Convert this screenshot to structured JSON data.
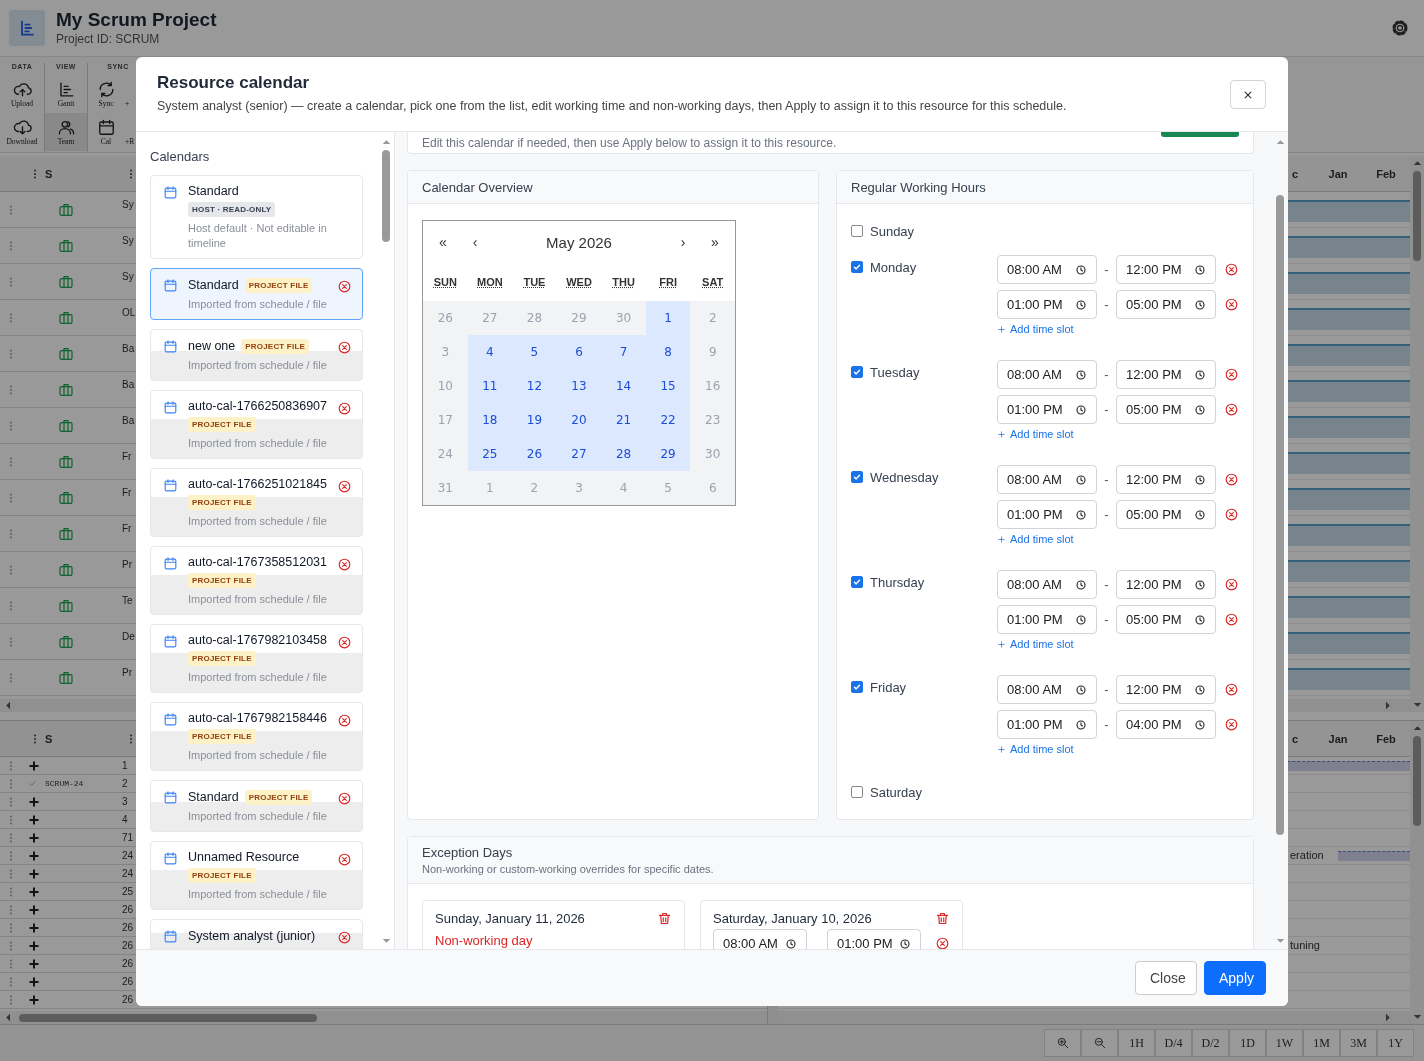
{
  "app": {
    "title": "My Scrum Project",
    "subtitle": "Project ID: SCRUM"
  },
  "toolbar": {
    "groups": [
      {
        "label": "DATA",
        "columns": [
          [
            {
              "label": "Upload",
              "selected": false
            },
            {
              "label": "Download",
              "selected": false
            }
          ]
        ]
      },
      {
        "label": "VIEW",
        "columns": [
          [
            {
              "label": "Gantt",
              "selected": false
            },
            {
              "label": "Team",
              "selected": true
            }
          ]
        ]
      },
      {
        "label": "SYNC",
        "columns": [
          [
            {
              "label": "Sync",
              "selected": false
            },
            {
              "label": "Cal",
              "selected": false
            }
          ],
          [
            {
              "label": "+",
              "selected": false
            },
            {
              "label": "+R",
              "selected": false
            }
          ]
        ]
      }
    ]
  },
  "upper_grid": {
    "column_1": "S",
    "months": [
      "c",
      "Jan",
      "Feb"
    ],
    "rows": [
      {
        "text": "Sy"
      },
      {
        "text": "Sy"
      },
      {
        "text": "Sy"
      },
      {
        "text": "OL"
      },
      {
        "text": "Ba"
      },
      {
        "text": "Ba"
      },
      {
        "text": "Ba"
      },
      {
        "text": "Fr"
      },
      {
        "text": "Fr"
      },
      {
        "text": "Fr"
      },
      {
        "text": "Pr"
      },
      {
        "text": "Te"
      },
      {
        "text": "De"
      },
      {
        "text": "Pr"
      }
    ]
  },
  "lower_grid": {
    "column_1": "S",
    "months": [
      "c",
      "Jan",
      "Feb"
    ],
    "rows": [
      {
        "kind": "new",
        "number": "1",
        "bar": true
      },
      {
        "kind": "done",
        "key": "SCRUM-24",
        "number": "2",
        "bar": false
      },
      {
        "kind": "new",
        "number": "3",
        "bar": false
      },
      {
        "kind": "new",
        "number": "4",
        "bar": false
      },
      {
        "kind": "new",
        "number": "71",
        "bar": false
      },
      {
        "kind": "new",
        "number": "24",
        "bar": true,
        "gantt_label": "eration"
      },
      {
        "kind": "new",
        "number": "24",
        "bar": false
      },
      {
        "kind": "new",
        "number": "25",
        "bar": false
      },
      {
        "kind": "new",
        "number": "26",
        "bar": false
      },
      {
        "kind": "new",
        "number": "26",
        "bar": false
      },
      {
        "kind": "new",
        "number": "26",
        "bar": false,
        "gantt_label": "tuning"
      },
      {
        "kind": "new",
        "number": "26",
        "bar": false
      },
      {
        "kind": "new",
        "number": "26",
        "bar": false
      },
      {
        "kind": "new",
        "number": "26",
        "bar": false
      }
    ]
  },
  "bottom_bar": {
    "scales": [
      "1H",
      "D/4",
      "D/2",
      "1D",
      "1W",
      "1M",
      "3M",
      "1Y"
    ]
  },
  "modal": {
    "title": "Resource calendar",
    "subtitle": "System analyst (senior) — create a calendar, pick one from the list, edit working time and non-working days, then Apply to assign it to this resource for this schedule.",
    "intro": "Edit this calendar if needed, then use Apply below to assign it to this resource.",
    "calendars_heading": "Calendars",
    "calendars": [
      {
        "kind": "host",
        "name": "Standard",
        "badge": "HOST · READ-ONLY",
        "note": "Host default · Not editable in timeline",
        "selected": false
      },
      {
        "kind": "project",
        "name": "Standard",
        "badge": "PROJECT FILE",
        "note": "Imported from schedule / file",
        "selected": true
      },
      {
        "kind": "project",
        "name": "new one",
        "badge": "PROJECT FILE",
        "note": "Imported from schedule / file",
        "selected": false
      },
      {
        "kind": "project",
        "name": "auto-cal-1766250836907",
        "badge": "PROJECT FILE",
        "note": "Imported from schedule / file",
        "selected": false
      },
      {
        "kind": "project",
        "name": "auto-cal-1766251021845",
        "badge": "PROJECT FILE",
        "note": "Imported from schedule / file",
        "selected": false
      },
      {
        "kind": "project",
        "name": "auto-cal-1767358512031",
        "badge": "PROJECT FILE",
        "note": "Imported from schedule / file",
        "selected": false
      },
      {
        "kind": "project",
        "name": "auto-cal-1767982103458",
        "badge": "PROJECT FILE",
        "note": "Imported from schedule / file",
        "selected": false
      },
      {
        "kind": "project",
        "name": "auto-cal-1767982158446",
        "badge": "PROJECT FILE",
        "note": "Imported from schedule / file",
        "selected": false
      },
      {
        "kind": "project",
        "name": "Standard",
        "badge": "PROJECT FILE",
        "note": "Imported from schedule / file",
        "selected": false
      },
      {
        "kind": "project",
        "name": "Unnamed Resource",
        "badge": "PROJECT FILE",
        "note": "Imported from schedule / file",
        "selected": false
      },
      {
        "kind": "project",
        "name": "System analyst (junior)",
        "selected": false
      }
    ],
    "overview": {
      "title": "Calendar Overview",
      "month": "May 2026",
      "nav": [
        "«",
        "‹",
        "›",
        "»"
      ],
      "weekdays": [
        "SUN",
        "MON",
        "TUE",
        "WED",
        "THU",
        "FRI",
        "SAT"
      ],
      "weeks": [
        [
          {
            "day": "26",
            "working": false
          },
          {
            "day": "27",
            "working": false
          },
          {
            "day": "28",
            "working": false
          },
          {
            "day": "29",
            "working": false
          },
          {
            "day": "30",
            "working": false
          },
          {
            "day": "1",
            "working": true
          },
          {
            "day": "2",
            "working": false
          }
        ],
        [
          {
            "day": "3",
            "working": false
          },
          {
            "day": "4",
            "working": true
          },
          {
            "day": "5",
            "working": true
          },
          {
            "day": "6",
            "working": true
          },
          {
            "day": "7",
            "working": true
          },
          {
            "day": "8",
            "working": true
          },
          {
            "day": "9",
            "working": false
          }
        ],
        [
          {
            "day": "10",
            "working": false
          },
          {
            "day": "11",
            "working": true
          },
          {
            "day": "12",
            "working": true
          },
          {
            "day": "13",
            "working": true
          },
          {
            "day": "14",
            "working": true
          },
          {
            "day": "15",
            "working": true
          },
          {
            "day": "16",
            "working": false
          }
        ],
        [
          {
            "day": "17",
            "working": false
          },
          {
            "day": "18",
            "working": true
          },
          {
            "day": "19",
            "working": true
          },
          {
            "day": "20",
            "working": true
          },
          {
            "day": "21",
            "working": true
          },
          {
            "day": "22",
            "working": true
          },
          {
            "day": "23",
            "working": false
          }
        ],
        [
          {
            "day": "24",
            "working": false
          },
          {
            "day": "25",
            "working": true
          },
          {
            "day": "26",
            "working": true
          },
          {
            "day": "27",
            "working": true
          },
          {
            "day": "28",
            "working": true
          },
          {
            "day": "29",
            "working": true
          },
          {
            "day": "30",
            "working": false
          }
        ],
        [
          {
            "day": "31",
            "working": false
          },
          {
            "day": "1",
            "working": false
          },
          {
            "day": "2",
            "working": false
          },
          {
            "day": "3",
            "working": false
          },
          {
            "day": "4",
            "working": false
          },
          {
            "day": "5",
            "working": false
          },
          {
            "day": "6",
            "working": false
          }
        ]
      ]
    },
    "working_hours": {
      "title": "Regular Working Hours",
      "days": [
        {
          "name": "Sunday",
          "checked": false
        },
        {
          "name": "Monday",
          "checked": true,
          "slots": [
            {
              "start": "08:00 AM",
              "separator": "-",
              "end": "12:00 PM"
            },
            {
              "start": "01:00 PM",
              "separator": "-",
              "end": "05:00 PM"
            }
          ],
          "add_slot": "Add time slot"
        },
        {
          "name": "Tuesday",
          "checked": true,
          "slots": [
            {
              "start": "08:00 AM",
              "separator": "-",
              "end": "12:00 PM"
            },
            {
              "start": "01:00 PM",
              "separator": "-",
              "end": "05:00 PM"
            }
          ],
          "add_slot": "Add time slot"
        },
        {
          "name": "Wednesday",
          "checked": true,
          "slots": [
            {
              "start": "08:00 AM",
              "separator": "-",
              "end": "12:00 PM"
            },
            {
              "start": "01:00 PM",
              "separator": "-",
              "end": "05:00 PM"
            }
          ],
          "add_slot": "Add time slot"
        },
        {
          "name": "Thursday",
          "checked": true,
          "slots": [
            {
              "start": "08:00 AM",
              "separator": "-",
              "end": "12:00 PM"
            },
            {
              "start": "01:00 PM",
              "separator": "-",
              "end": "05:00 PM"
            }
          ],
          "add_slot": "Add time slot"
        },
        {
          "name": "Friday",
          "checked": true,
          "slots": [
            {
              "start": "08:00 AM",
              "separator": "-",
              "end": "12:00 PM"
            },
            {
              "start": "01:00 PM",
              "separator": "-",
              "end": "04:00 PM"
            }
          ],
          "add_slot": "Add time slot"
        },
        {
          "name": "Saturday",
          "checked": false
        }
      ]
    },
    "exceptions": {
      "title": "Exception Days",
      "subtitle": "Non-working or custom-working overrides for specific dates.",
      "items": [
        {
          "kind": "off",
          "date": "Sunday, January 11, 2026",
          "note": "Non-working day"
        },
        {
          "kind": "custom",
          "date": "Saturday, January 10, 2026",
          "slots": [
            {
              "start": "08:00 AM",
              "end": "01:00 PM"
            }
          ]
        }
      ]
    },
    "buttons": [
      {
        "label": "Close",
        "kind": "secondary"
      },
      {
        "label": "Apply",
        "kind": "primary"
      }
    ]
  }
}
